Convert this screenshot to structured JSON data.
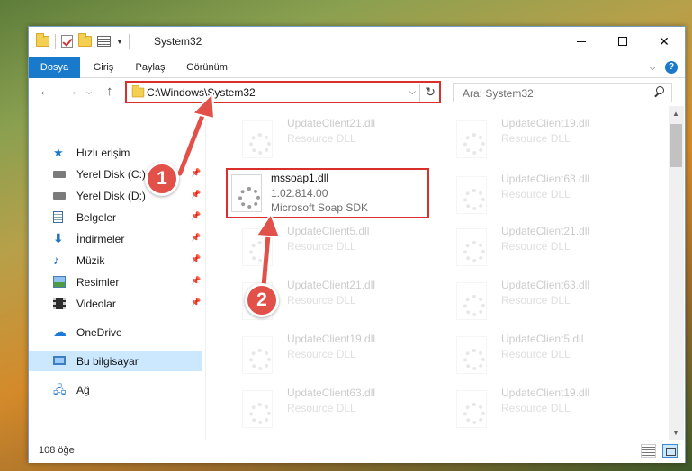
{
  "window": {
    "title": "System32",
    "controls": {
      "minimize": "minimize",
      "maximize": "maximize",
      "close": "✕"
    }
  },
  "ribbon": {
    "tabs": [
      "Dosya",
      "Giriş",
      "Paylaş",
      "Görünüm"
    ],
    "help": "?"
  },
  "address": {
    "path": "C:\\Windows\\System32",
    "search_placeholder": "Ara: System32"
  },
  "navigation": {
    "items": [
      {
        "label": "Hızlı erişim",
        "icon": "star-icon",
        "pinned": false
      },
      {
        "label": "Yerel Disk (C:)",
        "icon": "drive-icon",
        "pinned": true
      },
      {
        "label": "Yerel Disk (D:)",
        "icon": "drive-icon",
        "pinned": true
      },
      {
        "label": "Belgeler",
        "icon": "documents-icon",
        "pinned": true
      },
      {
        "label": "İndirmeler",
        "icon": "download-icon",
        "pinned": true
      },
      {
        "label": "Müzik",
        "icon": "music-icon",
        "pinned": true
      },
      {
        "label": "Resimler",
        "icon": "pictures-icon",
        "pinned": true
      },
      {
        "label": "Videolar",
        "icon": "videos-icon",
        "pinned": true
      },
      {
        "label": "OneDrive",
        "icon": "onedrive-icon",
        "pinned": false
      },
      {
        "label": "Bu bilgisayar",
        "icon": "computer-icon",
        "pinned": false,
        "selected": true
      },
      {
        "label": "Ağ",
        "icon": "network-icon",
        "pinned": false
      }
    ]
  },
  "files": {
    "highlighted": {
      "name": "mssoap1.dll",
      "version": "1.02.814.00",
      "description": "Microsoft Soap SDK"
    },
    "background": [
      {
        "name": "UpdateClient21.dll",
        "type": "Resource DLL"
      },
      {
        "name": "UpdateClient19.dll",
        "type": "Resource DLL"
      },
      {
        "name": "UpdateClient63.dll",
        "type": "Resource DLL"
      },
      {
        "name": "UpdateClient5.dll",
        "type": "Resource DLL"
      },
      {
        "name": "UpdateClient21.dll",
        "type": "Resource DLL"
      },
      {
        "name": "UpdateClient21.dll",
        "type": "Resource DLL"
      },
      {
        "name": "UpdateClient63.dll",
        "type": "Resource DLL"
      },
      {
        "name": "UpdateClient19.dll",
        "type": "Resource DLL"
      },
      {
        "name": "UpdateClient5.dll",
        "type": "Resource DLL"
      },
      {
        "name": "UpdateClient63.dll",
        "type": "Resource DLL"
      },
      {
        "name": "UpdateClient19.dll",
        "type": "Resource DLL"
      }
    ]
  },
  "status": {
    "item_count": "108 öğe"
  },
  "annotations": {
    "step1": "1",
    "step2": "2",
    "color": "#e2504a"
  }
}
